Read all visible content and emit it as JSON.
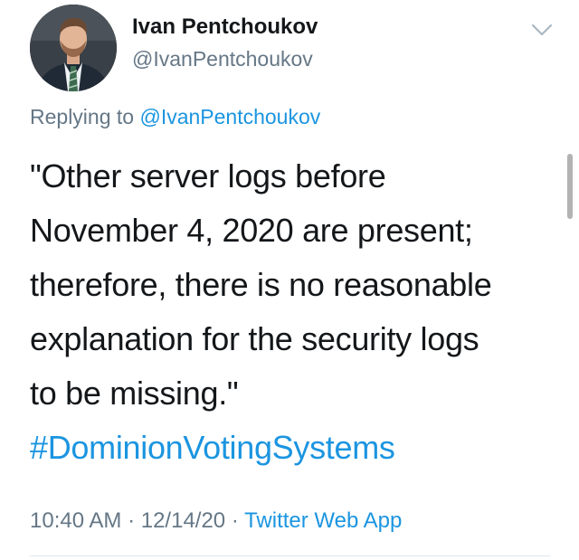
{
  "author": {
    "display_name": "Ivan Pentchoukov",
    "handle": "@IvanPentchoukov",
    "avatar_icon": "profile-photo"
  },
  "menu_icon": "chevron-down-icon",
  "reply": {
    "prefix": "Replying to ",
    "mention": "@IvanPentchoukov"
  },
  "tweet": {
    "lines": [
      "\"Other server logs before",
      "November 4, 2020 are present;",
      "therefore, there is no reasonable",
      "explanation for the security logs",
      "to be missing.\""
    ],
    "hashtag": "#DominionVotingSystems"
  },
  "meta": {
    "time": "10:40 AM",
    "separator": " · ",
    "date": "12/14/20",
    "source": "Twitter Web App"
  },
  "colors": {
    "link": "#1b95e0",
    "secondary_text": "#657786",
    "primary_text": "#14171a"
  }
}
